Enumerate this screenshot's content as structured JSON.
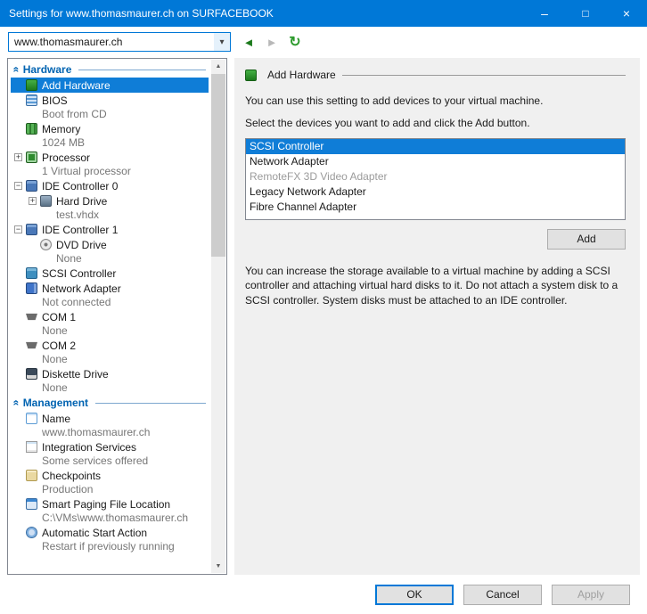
{
  "window": {
    "title": "Settings for www.thomasmaurer.ch on SURFACEBOOK"
  },
  "icons": {
    "minimize": "–",
    "maximize": "□",
    "close": "×",
    "dropdown": "▾",
    "back": "◄",
    "forward": "►",
    "refresh": "↻",
    "collapse_section": "«",
    "scroll_up": "▲",
    "scroll_down": "▼"
  },
  "toolbar": {
    "vm_selector_value": "www.thomasmaurer.ch"
  },
  "tree": {
    "sections": [
      {
        "label": "Hardware",
        "items": [
          {
            "icon": "add-hardware",
            "label": "Add Hardware",
            "sub": null,
            "selected": true,
            "level": 0,
            "expander": null
          },
          {
            "icon": "bios",
            "label": "BIOS",
            "sub": "Boot from CD",
            "selected": false,
            "level": 0,
            "expander": null
          },
          {
            "icon": "memory",
            "label": "Memory",
            "sub": "1024 MB",
            "selected": false,
            "level": 0,
            "expander": null
          },
          {
            "icon": "processor",
            "label": "Processor",
            "sub": "1 Virtual processor",
            "selected": false,
            "level": 0,
            "expander": "+"
          },
          {
            "icon": "ide-controller",
            "label": "IDE Controller 0",
            "sub": null,
            "selected": false,
            "level": 0,
            "expander": "−"
          },
          {
            "icon": "hard-drive",
            "label": "Hard Drive",
            "sub": "test.vhdx",
            "selected": false,
            "level": 1,
            "expander": "+"
          },
          {
            "icon": "ide-controller",
            "label": "IDE Controller 1",
            "sub": null,
            "selected": false,
            "level": 0,
            "expander": "−"
          },
          {
            "icon": "dvd-drive",
            "label": "DVD Drive",
            "sub": "None",
            "selected": false,
            "level": 1,
            "expander": null
          },
          {
            "icon": "scsi-controller",
            "label": "SCSI Controller",
            "sub": null,
            "selected": false,
            "level": 0,
            "expander": null
          },
          {
            "icon": "network-adapter",
            "label": "Network Adapter",
            "sub": "Not connected",
            "selected": false,
            "level": 0,
            "expander": null
          },
          {
            "icon": "com-port",
            "label": "COM 1",
            "sub": "None",
            "selected": false,
            "level": 0,
            "expander": null
          },
          {
            "icon": "com-port",
            "label": "COM 2",
            "sub": "None",
            "selected": false,
            "level": 0,
            "expander": null
          },
          {
            "icon": "diskette-drive",
            "label": "Diskette Drive",
            "sub": "None",
            "selected": false,
            "level": 0,
            "expander": null
          }
        ]
      },
      {
        "label": "Management",
        "items": [
          {
            "icon": "name",
            "label": "Name",
            "sub": "www.thomasmaurer.ch",
            "selected": false,
            "level": 0,
            "expander": null
          },
          {
            "icon": "integration-services",
            "label": "Integration Services",
            "sub": "Some services offered",
            "selected": false,
            "level": 0,
            "expander": null
          },
          {
            "icon": "checkpoints",
            "label": "Checkpoints",
            "sub": "Production",
            "selected": false,
            "level": 0,
            "expander": null
          },
          {
            "icon": "smart-paging",
            "label": "Smart Paging File Location",
            "sub": "C:\\VMs\\www.thomasmaurer.ch",
            "selected": false,
            "level": 0,
            "expander": null
          },
          {
            "icon": "auto-start",
            "label": "Automatic Start Action",
            "sub": "Restart if previously running",
            "selected": false,
            "level": 0,
            "expander": null
          }
        ]
      }
    ]
  },
  "content": {
    "header": "Add Hardware",
    "intro": "You can use this setting to add devices to your virtual machine.",
    "instruction": "Select the devices you want to add and click the Add button.",
    "devices": [
      {
        "label": "SCSI Controller",
        "state": "selected"
      },
      {
        "label": "Network Adapter",
        "state": "normal"
      },
      {
        "label": "RemoteFX 3D Video Adapter",
        "state": "disabled"
      },
      {
        "label": "Legacy Network Adapter",
        "state": "normal"
      },
      {
        "label": "Fibre Channel Adapter",
        "state": "normal"
      }
    ],
    "add_button": "Add",
    "description": "You can increase the storage available to a virtual machine by adding a SCSI controller and attaching virtual hard disks to it. Do not attach a system disk to a SCSI controller. System disks must be attached to an IDE controller."
  },
  "footer": {
    "ok": "OK",
    "cancel": "Cancel",
    "apply": "Apply"
  }
}
